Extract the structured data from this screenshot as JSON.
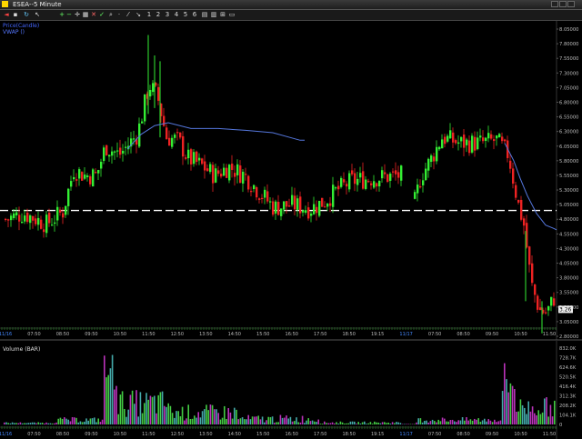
{
  "window": {
    "title": "ESEA--5 Minute"
  },
  "toolbar": {
    "icons": [
      "plus-icon",
      "minus-icon",
      "crosshair-icon",
      "grid-icon",
      "cross-icon",
      "check-icon",
      "zoom-icon"
    ],
    "period_buttons": [
      "1",
      "2",
      "3",
      "4",
      "5",
      "6"
    ]
  },
  "price_panel": {
    "legend": [
      "Price(Candle)",
      "VWAP ()"
    ],
    "reference_level": 4.95,
    "current_price_marker": "3.26",
    "price_ticks": [
      "8.05000",
      "7.80000",
      "7.55000",
      "7.30000",
      "7.05000",
      "6.80000",
      "6.55000",
      "6.30000",
      "6.05000",
      "5.80000",
      "5.55000",
      "5.30000",
      "5.05000",
      "4.80000",
      "4.55000",
      "4.30000",
      "4.05000",
      "3.80000",
      "3.55000",
      "3.30000",
      "3.05000",
      "2.80000"
    ],
    "time_ticks": [
      "11/16",
      "07:50",
      "08:50",
      "09:50",
      "10:50",
      "11:50",
      "12:50",
      "13:50",
      "14:50",
      "15:50",
      "16:50",
      "17:50",
      "18:50",
      "19:15",
      "11/17",
      "07:50",
      "08:50",
      "09:50",
      "10:50",
      "11:50"
    ]
  },
  "volume_panel": {
    "title": "Volume (BAR)",
    "volume_ticks": [
      "832.0K",
      "728.7K",
      "624.6K",
      "520.5K",
      "416.4K",
      "312.3K",
      "208.2K",
      "104.1K",
      "0"
    ],
    "time_ticks": [
      "11/16",
      "07:50",
      "08:50",
      "09:50",
      "10:50",
      "11:50",
      "12:50",
      "13:50",
      "14:50",
      "15:50",
      "16:50",
      "17:50",
      "18:50",
      "19:15",
      "11/17",
      "07:50",
      "08:50",
      "09:50",
      "10:50",
      "11:50"
    ]
  },
  "colors": {
    "up": "#33ee33",
    "down": "#ee2222",
    "vwap": "#5577dd",
    "axis_text": "#bbbbbb",
    "legend_text": "#5577ff",
    "grid_tick": "#2f8f2f",
    "volume_green": "#44cc44",
    "volume_magenta": "#bb33bb",
    "volume_teal": "#44aaaa",
    "reference_line": "#ffffff"
  }
}
